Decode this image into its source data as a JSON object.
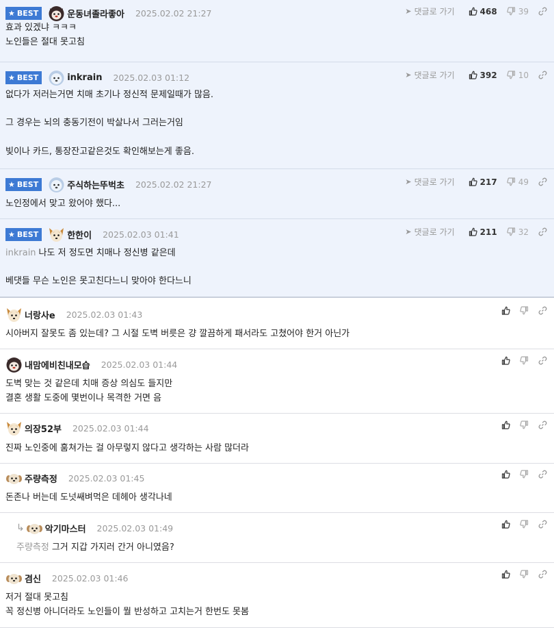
{
  "ui": {
    "best_label": "BEST",
    "reply_link_label": "댓글로 가기"
  },
  "comments": [
    {
      "best": true,
      "avatar": "cat-face-icon",
      "nick": "운동녀졸라좋아",
      "date": "2025.02.02 21:27",
      "up": "468",
      "down": "39",
      "mention": "",
      "lines": [
        "효과 있겠냐 ㅋㅋㅋ",
        "노인들은 절대 못고침"
      ]
    },
    {
      "best": true,
      "avatar": "bear-face-icon",
      "nick": "inkrain",
      "date": "2025.02.03 01:12",
      "up": "392",
      "down": "10",
      "mention": "",
      "lines": [
        "없다가 저러는거면 치매 초기나 정신적 문제일때가 많음.",
        "",
        "그 경우는 뇌의 충동기전이 박살나서 그러는거임",
        "",
        "빚이나 카드, 통장잔고같은것도 확인해보는게 좋음."
      ]
    },
    {
      "best": true,
      "avatar": "bear-face-icon",
      "nick": "주식하는뚜벅초",
      "date": "2025.02.02 21:27",
      "up": "217",
      "down": "49",
      "mention": "",
      "lines": [
        "노인정에서 맞고 왔어야 했다..."
      ]
    },
    {
      "best": true,
      "avatar": "dog-face-icon",
      "nick": "한한이",
      "date": "2025.02.03 01:41",
      "up": "211",
      "down": "32",
      "mention": "inkrain",
      "lines": [
        "나도 저 정도면 치매나 정신병 같은데",
        "",
        "베댓들 무슨 노인은 못고친다느니 맞아야 한다느니"
      ]
    },
    {
      "best": false,
      "avatar": "dog-face-icon",
      "nick": "너랑사e",
      "date": "2025.02.03 01:43",
      "mention": "",
      "lines": [
        "시아버지 잘못도 좀 있는데? 그 시절 도벽 버릇은 걍 깔끔하게 패서라도 고쳤어야 한거 아닌가"
      ]
    },
    {
      "best": false,
      "avatar": "cat-face-icon",
      "nick": "내맘에비친내모습",
      "date": "2025.02.03 01:44",
      "mention": "",
      "lines": [
        "도벽 맞는 것 같은데 치매 증상 의심도 들지만",
        "결혼 생활 도중에 몇번이나 목격한 거면 음"
      ]
    },
    {
      "best": false,
      "avatar": "dog-face-icon",
      "nick": "의장52부",
      "date": "2025.02.03 01:44",
      "mention": "",
      "lines": [
        "진짜 노인중에 훔쳐가는 걸 아무렇지 않다고 생각하는 사람 많더라"
      ]
    },
    {
      "best": false,
      "avatar": "puppy-face-icon",
      "nick": "주량측정",
      "date": "2025.02.03 01:45",
      "mention": "",
      "lines": [
        "돈존나 버는데 도넛쌔벼먹은 데헤아 생각나네"
      ]
    },
    {
      "best": false,
      "reply": true,
      "avatar": "puppy-face-icon",
      "nick": "악기마스터",
      "date": "2025.02.03 01:49",
      "mention": "주량측정",
      "lines": [
        "그거 지갑 가지러 간거 아니였음?"
      ]
    },
    {
      "best": false,
      "avatar": "puppy-face-icon",
      "nick": "겸신",
      "date": "2025.02.03 01:46",
      "mention": "",
      "lines": [
        "저거 절대 못고침",
        "꼭 정신병 아니더라도 노인들이 뭘 반성하고 고치는거 한번도 못봄"
      ]
    }
  ]
}
